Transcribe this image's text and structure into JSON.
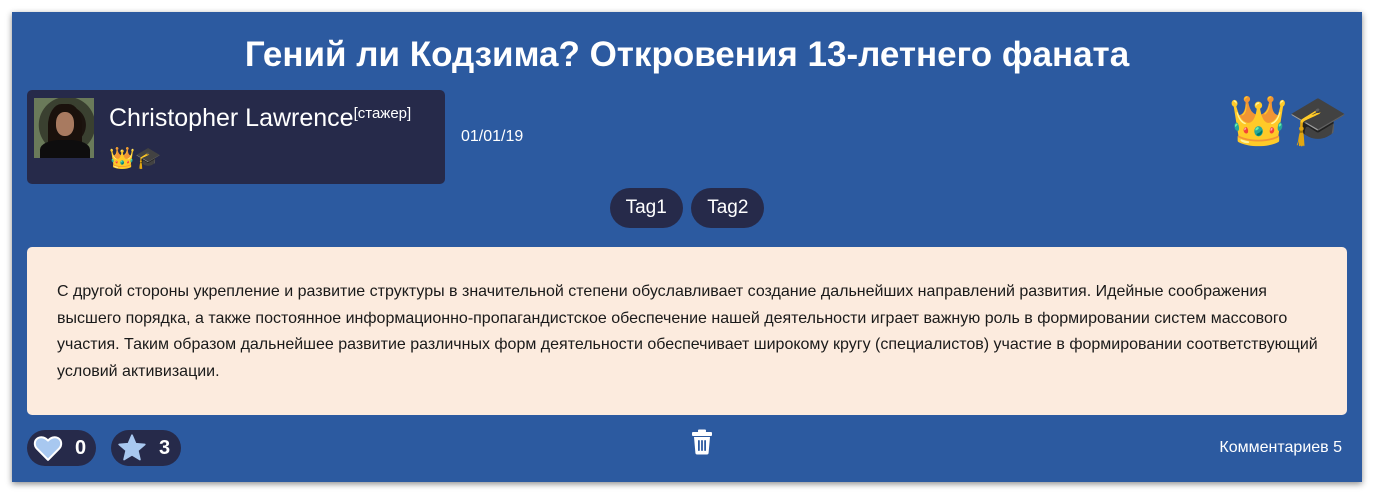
{
  "post": {
    "title": "Гений ли Кодзима? Откровения 13-летнего фаната",
    "date": "01/01/19",
    "body": "С другой стороны укрепление и развитие структуры в значительной степени обуславливает создание дальнейших направлений развития. Идейные соображения высшего порядка, а также постоянное информационно-пропагандистское обеспечение нашей деятельности играет важную роль в формировании систем массового участия. Таким образом дальнейшее развитие различных форм деятельности обеспечивает широкому кругу (специалистов) участие в формировании соответствующий условий активизации."
  },
  "author": {
    "name": "Christopher Lawrence",
    "rank": "[стажер]",
    "badges": [
      "crown-icon",
      "graduation-cap-icon"
    ]
  },
  "post_badges": [
    "crown-icon",
    "graduation-cap-icon"
  ],
  "tags": [
    {
      "label": "Tag1"
    },
    {
      "label": "Tag2"
    }
  ],
  "footer": {
    "likes": "0",
    "stars": "3",
    "comments_label": "Комментариев 5"
  },
  "colors": {
    "card_bg": "#2c5aa0",
    "dark_bg": "#262a4a",
    "content_bg": "#fcebde",
    "crown": "#f5a623",
    "cap": "#4a4f58",
    "heart": "#a8c8f0",
    "star": "#a8c8f0"
  }
}
